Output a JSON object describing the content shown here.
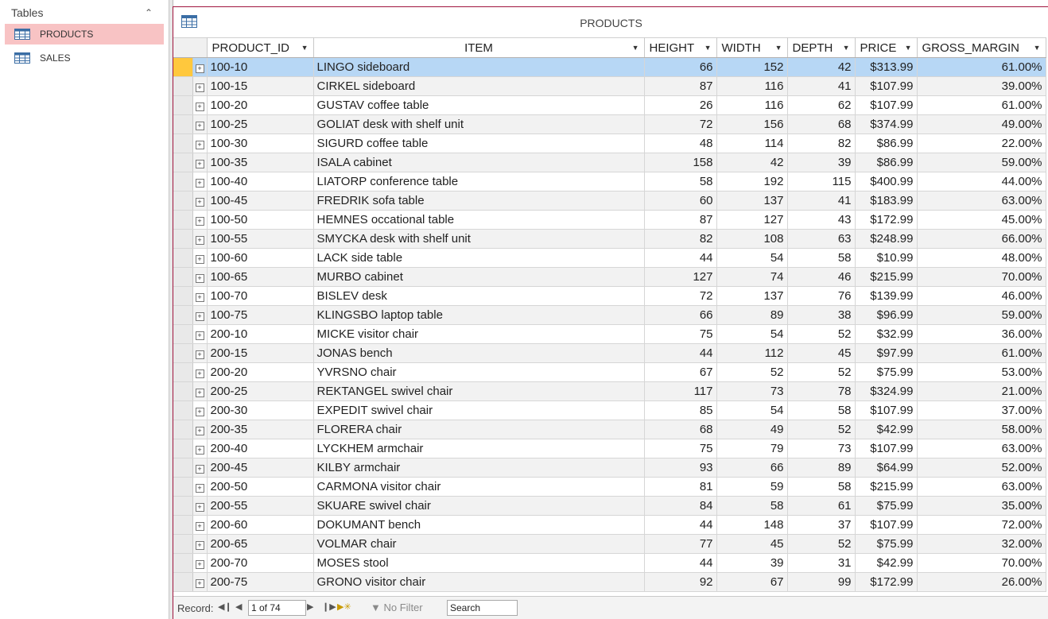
{
  "nav": {
    "header": "Tables",
    "items": [
      {
        "label": "PRODUCTS",
        "selected": true
      },
      {
        "label": "SALES",
        "selected": false
      }
    ]
  },
  "document": {
    "title": "PRODUCTS"
  },
  "table": {
    "columns": [
      "PRODUCT_ID",
      "ITEM",
      "HEIGHT",
      "WIDTH",
      "DEPTH",
      "PRICE",
      "GROSS_MARGIN"
    ],
    "rows": [
      [
        "100-10",
        "LINGO sideboard",
        "66",
        "152",
        "42",
        "$313.99",
        "61.00%"
      ],
      [
        "100-15",
        "CIRKEL sideboard",
        "87",
        "116",
        "41",
        "$107.99",
        "39.00%"
      ],
      [
        "100-20",
        "GUSTAV coffee table",
        "26",
        "116",
        "62",
        "$107.99",
        "61.00%"
      ],
      [
        "100-25",
        "GOLIAT desk with shelf unit",
        "72",
        "156",
        "68",
        "$374.99",
        "49.00%"
      ],
      [
        "100-30",
        "SIGURD coffee table",
        "48",
        "114",
        "82",
        "$86.99",
        "22.00%"
      ],
      [
        "100-35",
        "ISALA cabinet",
        "158",
        "42",
        "39",
        "$86.99",
        "59.00%"
      ],
      [
        "100-40",
        "LIATORP conference table",
        "58",
        "192",
        "115",
        "$400.99",
        "44.00%"
      ],
      [
        "100-45",
        "FREDRIK sofa table",
        "60",
        "137",
        "41",
        "$183.99",
        "63.00%"
      ],
      [
        "100-50",
        "HEMNES occational table",
        "87",
        "127",
        "43",
        "$172.99",
        "45.00%"
      ],
      [
        "100-55",
        "SMYCKA desk with shelf unit",
        "82",
        "108",
        "63",
        "$248.99",
        "66.00%"
      ],
      [
        "100-60",
        "LACK side table",
        "44",
        "54",
        "58",
        "$10.99",
        "48.00%"
      ],
      [
        "100-65",
        "MURBO cabinet",
        "127",
        "74",
        "46",
        "$215.99",
        "70.00%"
      ],
      [
        "100-70",
        "BISLEV desk",
        "72",
        "137",
        "76",
        "$139.99",
        "46.00%"
      ],
      [
        "100-75",
        "KLINGSBO laptop table",
        "66",
        "89",
        "38",
        "$96.99",
        "59.00%"
      ],
      [
        "200-10",
        "MICKE visitor chair",
        "75",
        "54",
        "52",
        "$32.99",
        "36.00%"
      ],
      [
        "200-15",
        "JONAS bench",
        "44",
        "112",
        "45",
        "$97.99",
        "61.00%"
      ],
      [
        "200-20",
        "YVRSNO chair",
        "67",
        "52",
        "52",
        "$75.99",
        "53.00%"
      ],
      [
        "200-25",
        "REKTANGEL swivel chair",
        "117",
        "73",
        "78",
        "$324.99",
        "21.00%"
      ],
      [
        "200-30",
        "EXPEDIT swivel chair",
        "85",
        "54",
        "58",
        "$107.99",
        "37.00%"
      ],
      [
        "200-35",
        "FLORERA chair",
        "68",
        "49",
        "52",
        "$42.99",
        "58.00%"
      ],
      [
        "200-40",
        "LYCKHEM armchair",
        "75",
        "79",
        "73",
        "$107.99",
        "63.00%"
      ],
      [
        "200-45",
        "KILBY armchair",
        "93",
        "66",
        "89",
        "$64.99",
        "52.00%"
      ],
      [
        "200-50",
        "CARMONA visitor chair",
        "81",
        "59",
        "58",
        "$215.99",
        "63.00%"
      ],
      [
        "200-55",
        "SKUARE swivel chair",
        "84",
        "58",
        "61",
        "$75.99",
        "35.00%"
      ],
      [
        "200-60",
        "DOKUMANT bench",
        "44",
        "148",
        "37",
        "$107.99",
        "72.00%"
      ],
      [
        "200-65",
        "VOLMAR chair",
        "77",
        "45",
        "52",
        "$75.99",
        "32.00%"
      ],
      [
        "200-70",
        "MOSES stool",
        "44",
        "39",
        "31",
        "$42.99",
        "70.00%"
      ],
      [
        "200-75",
        "GRONO visitor chair",
        "92",
        "67",
        "99",
        "$172.99",
        "26.00%"
      ]
    ]
  },
  "record_nav": {
    "label": "Record:",
    "counter": "1 of 74",
    "filter": "No Filter",
    "search": "Search"
  }
}
